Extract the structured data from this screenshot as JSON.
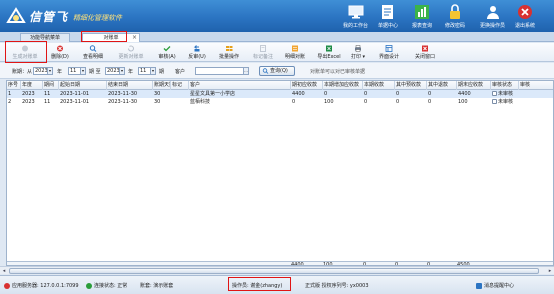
{
  "app": {
    "logo_name": "信管飞",
    "logo_subtitle": "精细化管理软件",
    "brand_color": "#2b74c2"
  },
  "topnav": [
    {
      "label": "我的工作台",
      "icon": "desktop-icon"
    },
    {
      "label": "单据中心",
      "icon": "documents-icon"
    },
    {
      "label": "报表查询",
      "icon": "report-icon"
    },
    {
      "label": "修改密码",
      "icon": "lock-icon"
    },
    {
      "label": "更换操作员",
      "icon": "switch-user-icon"
    },
    {
      "label": "退出系统",
      "icon": "exit-icon"
    }
  ],
  "tabs": [
    {
      "label": "功能导航菜单"
    },
    {
      "label": "对账单"
    }
  ],
  "toolbar": [
    {
      "label": "生成对账单",
      "icon": "generate-icon",
      "disabled": true
    },
    {
      "label": "删除(D)",
      "icon": "delete-icon",
      "disabled": false
    },
    {
      "label": "查看明细",
      "icon": "view-detail-icon",
      "disabled": false
    },
    {
      "label": "更新对账单",
      "icon": "refresh-icon",
      "disabled": true
    },
    {
      "label": "审核(A)",
      "icon": "approve-icon",
      "disabled": false
    },
    {
      "label": "反审(U)",
      "icon": "unapprove-icon",
      "disabled": false
    },
    {
      "label": "批量操作",
      "icon": "batch-icon",
      "disabled": false
    },
    {
      "label": "标记备注",
      "icon": "mark-note-icon",
      "disabled": true
    },
    {
      "label": "明细对账",
      "icon": "detail-reconcile-icon",
      "disabled": false
    },
    {
      "label": "导出Excel",
      "icon": "excel-icon",
      "disabled": false
    },
    {
      "label": "打印 ▾",
      "icon": "print-icon",
      "disabled": false
    },
    {
      "label": "界面设计",
      "icon": "layout-design-icon",
      "disabled": false
    },
    {
      "label": "关闭窗口",
      "icon": "close-window-icon",
      "disabled": false
    }
  ],
  "filter": {
    "date_label": "账期：从",
    "from_year": "2023",
    "year_label": "年",
    "from_month": "11",
    "month_to_label": "期 至",
    "to_year": "2023",
    "to_year_label": "年",
    "to_month": "11",
    "period_label": "期",
    "customer_label": "客户",
    "customer_value": "",
    "query_label": "查询(Q)",
    "hint": "对账单可以对已审核单据"
  },
  "grid": {
    "headers": [
      "序号",
      "年度",
      "期间",
      "起始日期",
      "结束日期",
      "账期天数",
      "标记",
      "客户",
      "期初应收款",
      "本期增加应收款",
      "本期收款",
      "其中预收款",
      "其中退款",
      "期末应收款",
      "审核状态",
      "审核"
    ],
    "rows": [
      [
        "1",
        "2023",
        "11",
        "2023-11-01",
        "2023-11-30",
        "30",
        "",
        "星星文具第一小学店",
        "4400",
        "0",
        "0",
        "0",
        "0",
        "4400",
        "未审核",
        ""
      ],
      [
        "2",
        "2023",
        "11",
        "2023-11-01",
        "2023-11-30",
        "30",
        "",
        "蓝栢科技",
        "0",
        "100",
        "0",
        "0",
        "0",
        "100",
        "未审核",
        ""
      ]
    ],
    "totals": {
      "opening": "4400",
      "increase": "100",
      "received": "0",
      "prepaid": "0",
      "refund": "0",
      "closing": "4500"
    }
  },
  "status": {
    "server": "应用服务器: 127.0.0.1:7099",
    "connection": "连接状态: 正常",
    "account": "账套: 演示账套",
    "operator": "操作员: 谢金(zhangy)",
    "version": "正式版  授权序列号: yx0003",
    "notify": "消息提醒中心"
  }
}
